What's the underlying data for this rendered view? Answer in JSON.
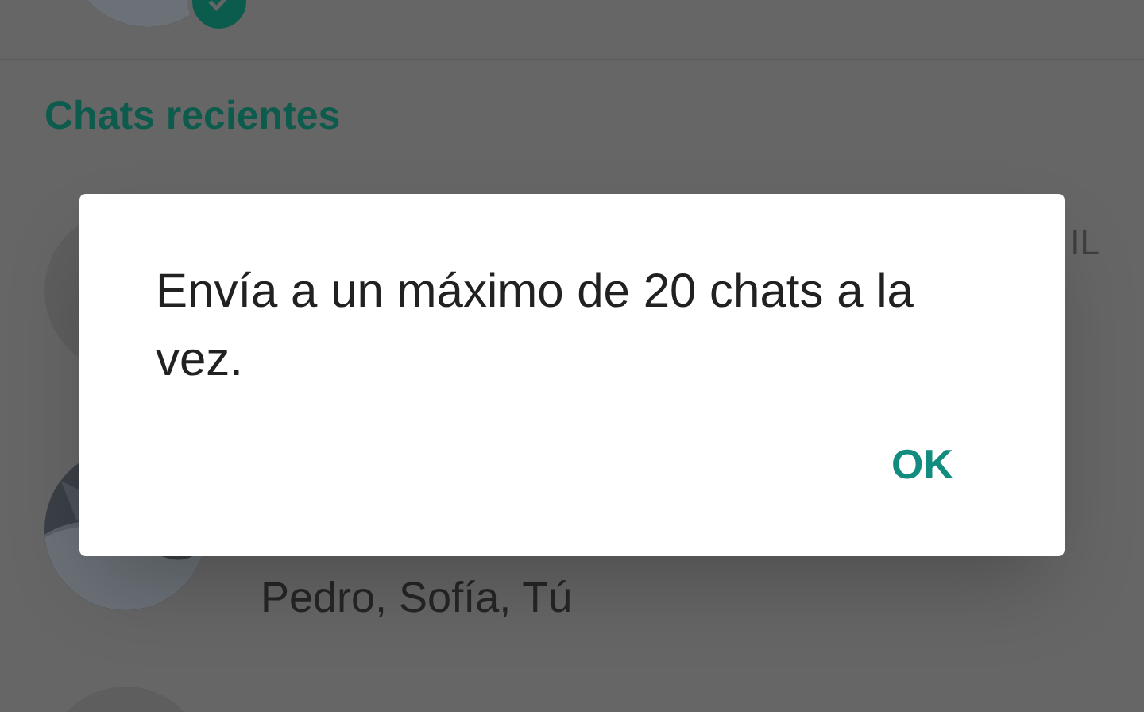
{
  "section_title": "Chats recientes",
  "chats": [
    {
      "selected": true,
      "kind": "picture"
    },
    {
      "selected": false,
      "kind": "plain",
      "right_text": "IL"
    },
    {
      "selected": false,
      "kind": "picture",
      "subtitle": "Pedro, Sofía, Tú"
    },
    {
      "selected": false,
      "kind": "plain"
    }
  ],
  "dialog": {
    "message": "Envía a un máximo de 20 chats a la vez.",
    "button": "OK"
  }
}
